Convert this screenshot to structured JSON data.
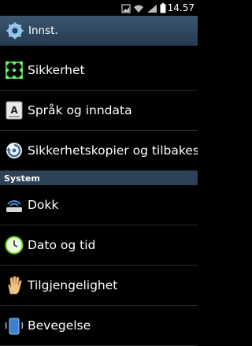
{
  "status_bar": {
    "time": "14.57",
    "icons": [
      "gallery-icon",
      "wifi-icon",
      "signal-icon",
      "battery-icon"
    ]
  },
  "action_bar": {
    "title": "Innst.",
    "icon": "settings-gear-icon"
  },
  "settings": [
    {
      "label": "Sikkerhet",
      "icon": "pattern-lock-icon"
    },
    {
      "label": "Språk og inndata",
      "icon": "keyboard-a-icon"
    },
    {
      "label": "Sikkerhetskopier og tilbakestill",
      "icon": "backup-restore-icon"
    }
  ],
  "system_section": {
    "title": "System",
    "items": [
      {
        "label": "Dokk",
        "icon": "dock-icon"
      },
      {
        "label": "Dato og tid",
        "icon": "clock-icon"
      },
      {
        "label": "Tilgjengelighet",
        "icon": "hand-icon"
      },
      {
        "label": "Bevegelse",
        "icon": "motion-icon"
      }
    ]
  },
  "colors": {
    "action_bar": "#2f4760",
    "section_header": "#2d4158",
    "background": "#000000"
  }
}
